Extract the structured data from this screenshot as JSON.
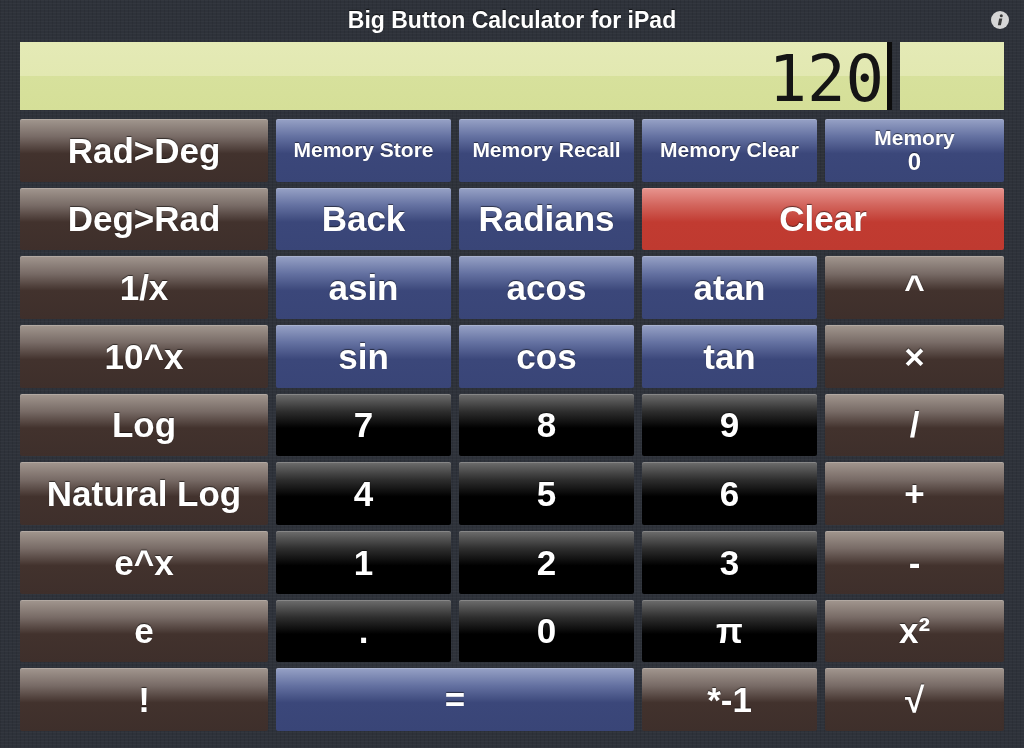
{
  "title": "Big Button Calculator for iPad",
  "display": {
    "value": "120"
  },
  "keypad": [
    [
      {
        "label": "Rad>Deg",
        "kind": "function",
        "wide": false
      },
      {
        "label": "Memory Store",
        "kind": "memory",
        "wide": false
      },
      {
        "label": "Memory Recall",
        "kind": "memory",
        "wide": false
      },
      {
        "label": "Memory Clear",
        "kind": "memory",
        "wide": false
      },
      {
        "label": "Memory",
        "value": "0",
        "kind": "memory",
        "wide": false
      }
    ],
    [
      {
        "label": "Deg>Rad",
        "kind": "function",
        "wide": false
      },
      {
        "label": "Back",
        "kind": "action",
        "wide": false
      },
      {
        "label": "Radians",
        "kind": "action",
        "wide": false
      },
      {
        "label": "Clear",
        "kind": "clear",
        "wide": true
      }
    ],
    [
      {
        "label": "1/x",
        "kind": "function",
        "wide": false
      },
      {
        "label": "asin",
        "kind": "trig",
        "wide": false
      },
      {
        "label": "acos",
        "kind": "trig",
        "wide": false
      },
      {
        "label": "atan",
        "kind": "trig",
        "wide": false
      },
      {
        "label": "^",
        "kind": "operator",
        "wide": false
      }
    ],
    [
      {
        "label": "10^x",
        "kind": "function",
        "wide": false
      },
      {
        "label": "sin",
        "kind": "trig",
        "wide": false
      },
      {
        "label": "cos",
        "kind": "trig",
        "wide": false
      },
      {
        "label": "tan",
        "kind": "trig",
        "wide": false
      },
      {
        "label": "×",
        "kind": "operator",
        "wide": false
      }
    ],
    [
      {
        "label": "Log",
        "kind": "function",
        "wide": false
      },
      {
        "label": "7",
        "kind": "digit",
        "wide": false
      },
      {
        "label": "8",
        "kind": "digit",
        "wide": false
      },
      {
        "label": "9",
        "kind": "digit",
        "wide": false
      },
      {
        "label": "/",
        "kind": "operator",
        "wide": false
      }
    ],
    [
      {
        "label": "Natural Log",
        "kind": "function",
        "wide": false
      },
      {
        "label": "4",
        "kind": "digit",
        "wide": false
      },
      {
        "label": "5",
        "kind": "digit",
        "wide": false
      },
      {
        "label": "6",
        "kind": "digit",
        "wide": false
      },
      {
        "label": "+",
        "kind": "operator",
        "wide": false
      }
    ],
    [
      {
        "label": "e^x",
        "kind": "function",
        "wide": false
      },
      {
        "label": "1",
        "kind": "digit",
        "wide": false
      },
      {
        "label": "2",
        "kind": "digit",
        "wide": false
      },
      {
        "label": "3",
        "kind": "digit",
        "wide": false
      },
      {
        "label": "-",
        "kind": "operator",
        "wide": false
      }
    ],
    [
      {
        "label": "e",
        "kind": "function",
        "wide": false
      },
      {
        "label": ".",
        "kind": "digit",
        "wide": false
      },
      {
        "label": "0",
        "kind": "digit",
        "wide": false
      },
      {
        "label": "π",
        "kind": "digit",
        "wide": false
      },
      {
        "label": "x²",
        "kind": "operator",
        "wide": false
      }
    ],
    [
      {
        "label": "!",
        "kind": "function",
        "wide": false
      },
      {
        "label": "=",
        "kind": "equals",
        "wide": true
      },
      {
        "label": "*-1",
        "kind": "operator",
        "wide": false
      },
      {
        "label": "√",
        "kind": "operator",
        "wide": false
      }
    ]
  ]
}
